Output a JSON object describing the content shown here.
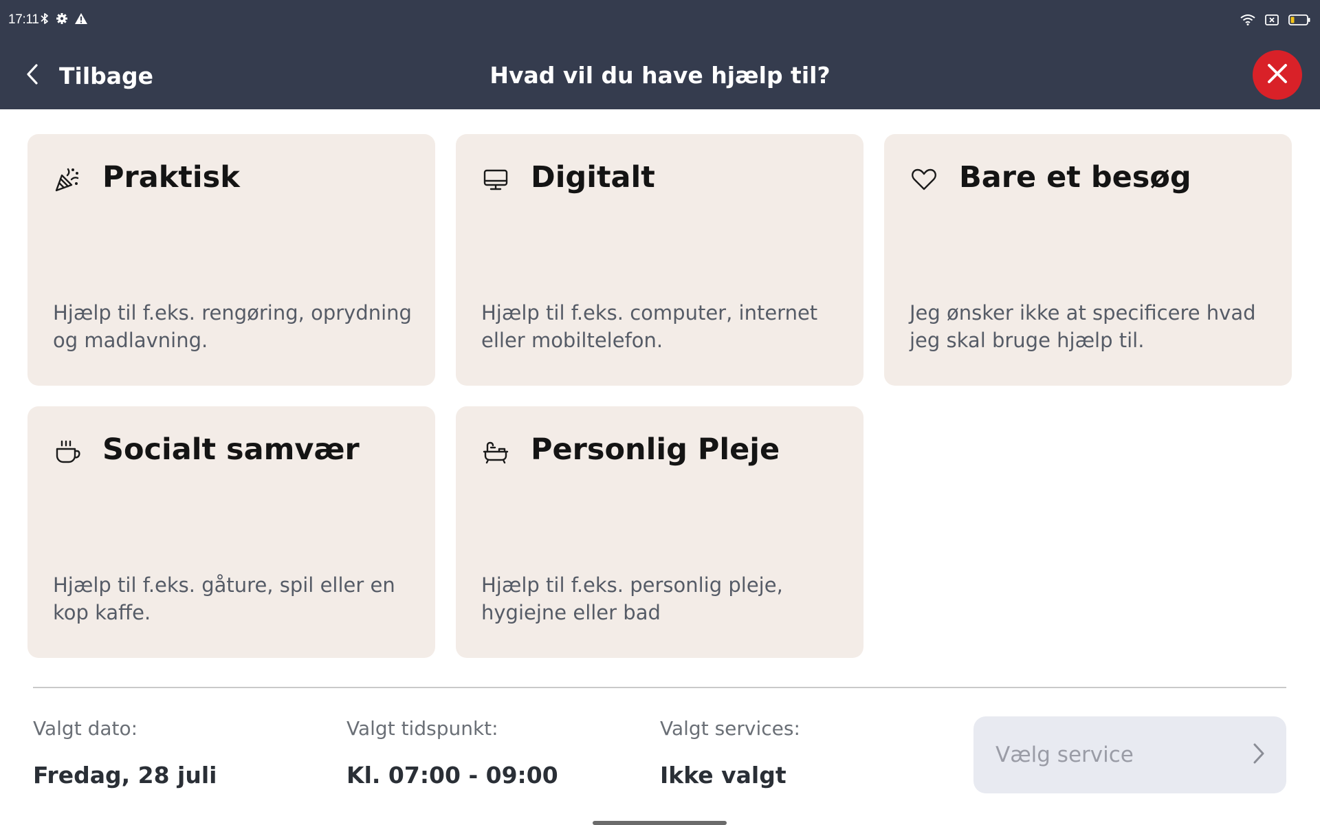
{
  "status_bar": {
    "time": "17:11",
    "left_icons": [
      "bluetooth-icon",
      "gear-icon",
      "warning-icon"
    ],
    "right_icons": [
      "wifi-icon",
      "sim-icon",
      "battery-icon"
    ]
  },
  "header": {
    "back_label": "Tilbage",
    "title": "Hvad vil du have hjælp til?",
    "close_icon": "close-icon"
  },
  "colors": {
    "header_bg": "#353c4e",
    "card_bg": "#f3ece7",
    "close_bg": "#d92128",
    "service_button_bg": "#e8eaf1"
  },
  "services": [
    {
      "id": "praktisk",
      "icon": "confetti-icon",
      "title": "Praktisk",
      "description": "Hjælp til f.eks. rengøring, oprydning og madlavning."
    },
    {
      "id": "digitalt",
      "icon": "monitor-icon",
      "title": "Digitalt",
      "description": "Hjælp til f.eks. computer, internet eller mobiltelefon."
    },
    {
      "id": "bare-et-besog",
      "icon": "heart-icon",
      "title": "Bare et besøg",
      "description": "Jeg ønsker ikke at specificere hvad jeg skal bruge hjælp til."
    },
    {
      "id": "socialt-samvaer",
      "icon": "coffee-cup-icon",
      "title": "Socialt samvær",
      "description": "Hjælp til f.eks. gåture, spil eller en kop kaffe."
    },
    {
      "id": "personlig-pleje",
      "icon": "bathtub-icon",
      "title": "Personlig Pleje",
      "description": "Hjælp til f.eks. personlig pleje, hygiejne eller bad"
    }
  ],
  "summary": {
    "date_label": "Valgt dato:",
    "date_value": "Fredag, 28 juli",
    "time_label": "Valgt tidspunkt:",
    "time_value": "Kl. 07:00 - 09:00",
    "services_label": "Valgt services:",
    "services_value": "Ikke valgt"
  },
  "footer": {
    "service_button_label": "Vælg service"
  }
}
